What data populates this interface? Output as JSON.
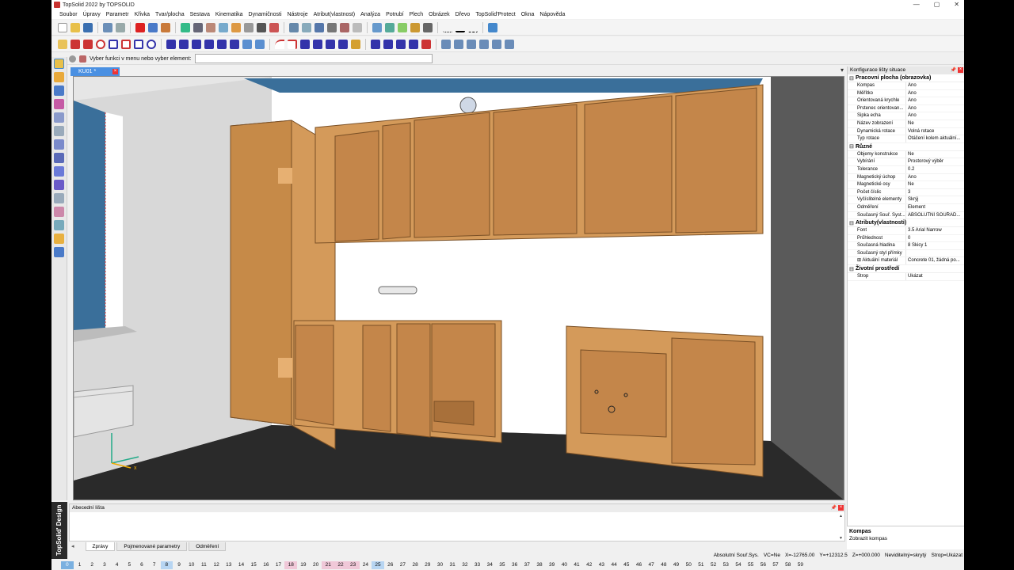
{
  "window": {
    "title": "TopSolid 2022 by TOPSOLID",
    "minimize": "—",
    "maximize": "▢",
    "close": "✕"
  },
  "menu": [
    "Soubor",
    "Úpravy",
    "Parametr",
    "Křivka",
    "Tvar/plocha",
    "Sestava",
    "Kinematika",
    "Dynamičnosti",
    "Nástroje",
    "Atribut(vlastnost)",
    "Analýza",
    "Potrubí",
    "Plech",
    "Obrázek",
    "Dřevo",
    "TopSolid'Protect",
    "Okna",
    "Nápověda"
  ],
  "command": {
    "prompt": "Vyber funkci v menu nebo vyber element:",
    "value": ""
  },
  "document_tab": {
    "label": "KU01 *",
    "close": "×"
  },
  "side_label": "TopSolid' Design",
  "properties_panel": {
    "title": "Konfigurace lišty situace",
    "pin": "📌",
    "close": "×",
    "sections": [
      {
        "name": "Pracovní plocha (obrazovka)",
        "rows": [
          {
            "k": "Kompas",
            "v": "Ano"
          },
          {
            "k": "Měřítko",
            "v": "Ano"
          },
          {
            "k": "Orientovaná krychle",
            "v": "Ano"
          },
          {
            "k": "Prstenec orientovan...",
            "v": "Ano"
          },
          {
            "k": "Šipka echa",
            "v": "Ano"
          },
          {
            "k": "Název zobrazení",
            "v": "Ne"
          },
          {
            "k": "Dynamická rotace",
            "v": "Volná rotace"
          },
          {
            "k": "Typ rotace",
            "v": "Otáčení kolem aktuální..."
          }
        ]
      },
      {
        "name": "Různé",
        "rows": [
          {
            "k": "Objemy konstrukce",
            "v": "Ne"
          },
          {
            "k": "Vybírání",
            "v": "Prostorový výběr"
          },
          {
            "k": "Tolerance",
            "v": "0.2"
          },
          {
            "k": "Magnetický úchop",
            "v": "Ano"
          },
          {
            "k": "Magnetické osy",
            "v": "Ne"
          },
          {
            "k": "Počet číslic",
            "v": "3"
          },
          {
            "k": "Vyčíslitelné elementy",
            "v": "Skrýj"
          },
          {
            "k": "Odměření",
            "v": "Element"
          },
          {
            "k": "Současný Souř. Syst...",
            "v": "ABSOLUTNÍ SOUŘAD..."
          }
        ]
      },
      {
        "name": "Atributy(vlastnosti)",
        "rows": [
          {
            "k": "Font",
            "v": "3.5  Arial Narrow"
          },
          {
            "k": "Průhlednost",
            "v": "0"
          },
          {
            "k": "Současná hladina",
            "v": "8 Skicy 1"
          },
          {
            "k": "Současný styl přímky",
            "v": ""
          },
          {
            "k": "⊞  Aktuální materiál",
            "v": "Concrete 01, žádná po..."
          }
        ]
      },
      {
        "name": "Životní prostředí",
        "rows": [
          {
            "k": "Strop",
            "v": "Ukázat"
          }
        ]
      }
    ]
  },
  "help_box": {
    "title": "Kompas",
    "text": "Zobrazit kompas"
  },
  "alphabetic_bar": {
    "title": "Abecední lišta",
    "pin": "📌",
    "close": "×",
    "scroll_up": "▲",
    "scroll_down": "▼"
  },
  "bottom_tabs": {
    "nav": "◂",
    "tabs": [
      "Zprávy",
      "Pojmenované parametry",
      "Odměření"
    ]
  },
  "status": {
    "coord_sys": "Absolutní Souř.Sys.",
    "vc": "VC=Ne",
    "x": "X=-12765.00",
    "y": "Y=+12312.5",
    "z": "Z=+000.000",
    "visibility": "Neviditelný=skrytý",
    "ceiling": "Strop=Ukázat"
  },
  "layers": [
    "0",
    "1",
    "2",
    "3",
    "4",
    "5",
    "6",
    "7",
    "8",
    "9",
    "10",
    "11",
    "12",
    "13",
    "14",
    "15",
    "16",
    "17",
    "18",
    "19",
    "20",
    "21",
    "22",
    "23",
    "24",
    "25",
    "26",
    "27",
    "28",
    "29",
    "30",
    "31",
    "32",
    "33",
    "34",
    "35",
    "36",
    "37",
    "38",
    "39",
    "40",
    "41",
    "42",
    "43",
    "44",
    "45",
    "46",
    "47",
    "48",
    "49",
    "50",
    "51",
    "52",
    "53",
    "54",
    "55",
    "56",
    "57",
    "58",
    "59"
  ],
  "colors": {
    "wood": "#d49a5a",
    "wood_dark": "#a8703a",
    "wall": "#ffffff",
    "floor": "#2a2a2a",
    "accent": "#4a90e2"
  }
}
